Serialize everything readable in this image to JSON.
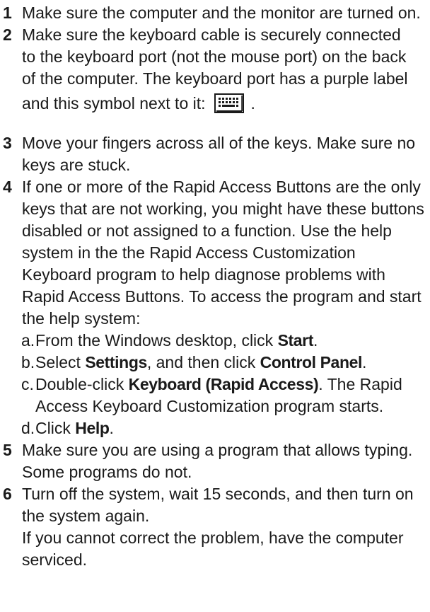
{
  "steps": [
    {
      "num": "1",
      "text": "Make sure the computer and the monitor are turned on."
    },
    {
      "num": "2",
      "text_lines": [
        "Make sure the keyboard cable is securely connected",
        "to the keyboard port (not the mouse port) on the back",
        "of the computer.  The keyboard port has a purple label"
      ],
      "text_before_icon": "and this symbol next to it:",
      "icon": "keyboard-icon",
      "text_after_icon": "."
    },
    {
      "num": "3",
      "text": "Move your fingers across all of the keys.  Make sure no keys are stuck."
    },
    {
      "num": "4",
      "text": "If  one or more of the Rapid Access Buttons are the only keys that are not working, you might have these buttons disabled or not assigned to a function. Use the help system in the the Rapid Access Customization Keyboard program to help diagnose problems with Rapid Access Buttons. To access the program and start the help system:",
      "subs": [
        {
          "letter": "a.",
          "pre": "From the Windows desktop, click ",
          "bold1": "Start",
          "mid": ".",
          "bold2": "",
          "post": ""
        },
        {
          "letter": "b.",
          "pre": "Select ",
          "bold1": "Settings",
          "mid": ",  and then click ",
          "bold2": "Control Panel",
          "post": "."
        },
        {
          "letter": "c.",
          "pre": "Double-click ",
          "bold1": "Keyboard (Rapid Access)",
          "mid": ". The Rapid Access Keyboard Customization program starts.",
          "bold2": "",
          "post": ""
        },
        {
          "letter": "d.",
          "pre": "Click ",
          "bold1": "Help",
          "mid": ".",
          "bold2": "",
          "post": ""
        }
      ]
    },
    {
      "num": "5",
      "text": "Make sure you are using a program that allows typing. Some programs do not."
    },
    {
      "num": "6",
      "text": "Turn off the system, wait 15 seconds, and then turn on the system again."
    }
  ],
  "closing": "If  you cannot correct the problem, have the computer serviced."
}
